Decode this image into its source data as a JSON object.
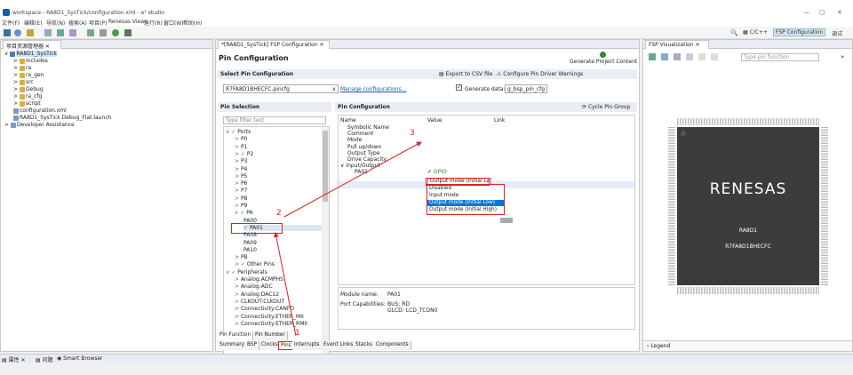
{
  "window": {
    "title": "workspace - RA8D1_SysTick/configuration.xml - e² studio",
    "controls": [
      "—",
      "▢",
      "✕"
    ]
  },
  "menu": [
    "文件(F)",
    "编辑(E)",
    "导航(N)",
    "搜索(A)",
    "项目(P)",
    "Renesas Views",
    "运行(R)",
    "窗口(W)",
    "帮助(H)"
  ],
  "perspective": {
    "c": "C/C++",
    "fsp": "FSP Configuration",
    "debug": "调试"
  },
  "project_explorer": {
    "tab": "项目资源管理器",
    "items": [
      {
        "label": "RA8D1_SysTick",
        "level": 0
      },
      {
        "label": "Includes",
        "level": 1
      },
      {
        "label": "ra",
        "level": 1
      },
      {
        "label": "ra_gen",
        "level": 1
      },
      {
        "label": "src",
        "level": 1
      },
      {
        "label": "Debug",
        "level": 1
      },
      {
        "label": "ra_cfg",
        "level": 1
      },
      {
        "label": "script",
        "level": 1
      },
      {
        "label": "configuration.xml",
        "level": 1
      },
      {
        "label": "RA8D1_SysTick Debug_Flat.launch",
        "level": 1
      },
      {
        "label": "Developer Assistance",
        "level": 0
      }
    ]
  },
  "editor": {
    "tab": "*[RA8D1_SysTick] FSP Configuration",
    "heading": "Pin Configuration",
    "generate": "Generate Project Content",
    "select_pin_cfg": "Select Pin Configuration",
    "export_csv": "Export to CSV file",
    "configure_warnings": "Configure Pin Driver Warnings",
    "pin_cfg_file": "R7FA8D1BHECFC.pincfg",
    "manage": "Manage configurations...",
    "generate_data_label": "Generate data:",
    "generate_data_value": "g_bsp_pin_cfg",
    "pin_selection": "Pin Selection",
    "pin_configuration": "Pin Configuration",
    "cycle": "Cycle Pin Group",
    "filter_placeholder": "Type filter text"
  },
  "pin_tree": [
    {
      "label": "Ports",
      "level": 0,
      "exp": "∨",
      "chk": true
    },
    {
      "label": "P0",
      "level": 1,
      "exp": ">"
    },
    {
      "label": "P1",
      "level": 1,
      "exp": ">"
    },
    {
      "label": "P2",
      "level": 1,
      "exp": ">",
      "chk": true
    },
    {
      "label": "P3",
      "level": 1,
      "exp": ">"
    },
    {
      "label": "P4",
      "level": 1,
      "exp": ">"
    },
    {
      "label": "P5",
      "level": 1,
      "exp": ">"
    },
    {
      "label": "P6",
      "level": 1,
      "exp": ">"
    },
    {
      "label": "P7",
      "level": 1,
      "exp": ">"
    },
    {
      "label": "P8",
      "level": 1,
      "exp": ">"
    },
    {
      "label": "P9",
      "level": 1,
      "exp": ">"
    },
    {
      "label": "PA",
      "level": 1,
      "exp": "∨",
      "chk": true
    },
    {
      "label": "PA00",
      "level": 2
    },
    {
      "label": "PA01",
      "level": 2,
      "chk": true,
      "sel": true
    },
    {
      "label": "PA08",
      "level": 2
    },
    {
      "label": "PA09",
      "level": 2
    },
    {
      "label": "PA10",
      "level": 2
    },
    {
      "label": "PB",
      "level": 1,
      "exp": ">"
    },
    {
      "label": "Other Pins",
      "level": 1,
      "exp": ">",
      "chk": true
    },
    {
      "label": "Peripherals",
      "level": 0,
      "exp": "∨",
      "chk": true
    },
    {
      "label": "Analog:ACMPHS",
      "level": 1,
      "exp": ">"
    },
    {
      "label": "Analog:ADC",
      "level": 1,
      "exp": ">"
    },
    {
      "label": "Analog:DAC12",
      "level": 1,
      "exp": ">"
    },
    {
      "label": "CLKOUT:CLKOUT",
      "level": 1,
      "exp": ">"
    },
    {
      "label": "Connectivity:CANFD",
      "level": 1,
      "exp": ">"
    },
    {
      "label": "Connectivity:ETHER_MII",
      "level": 1,
      "exp": ">"
    },
    {
      "label": "Connectivity:ETHER_RMII",
      "level": 1,
      "exp": ">"
    }
  ],
  "prop_table": {
    "headers": [
      "Name",
      "Value",
      "Link"
    ],
    "rows": [
      {
        "name": "Symbolic Name",
        "value": "",
        "level": 1
      },
      {
        "name": "Comment",
        "value": "",
        "level": 1
      },
      {
        "name": "Mode",
        "value": "Output mode (Initial L",
        "level": 1,
        "sel": true
      },
      {
        "name": "Pull up/down",
        "value": "",
        "level": 1
      },
      {
        "name": "Output Type",
        "value": "",
        "level": 1
      },
      {
        "name": "Drive Capacity",
        "value": "",
        "level": 1
      },
      {
        "name": "Input/Output",
        "value": "",
        "level": 0,
        "exp": "∨"
      },
      {
        "name": "PA01",
        "value": "✔ GPIO",
        "level": 2
      }
    ]
  },
  "mode_options": [
    "Disabled",
    "Input mode",
    "Output mode (Initial Low)",
    "Output mode (Initial High)"
  ],
  "module": {
    "name_label": "Module name:",
    "name": "PA01",
    "cap_label": "Port Capabilities:",
    "cap1": "BUS: RD",
    "cap2": "GLCD: LCD_TCON0"
  },
  "sub_tabs": [
    "Pin Function",
    "Pin Number"
  ],
  "bottom_tabs": [
    "Summary",
    "BSP",
    "Clocks",
    "Pins",
    "Interrupts",
    "Event Links",
    "Stacks",
    "Components"
  ],
  "fsp_vis": {
    "tab": "FSP Visualization",
    "search_placeholder": "Type pin function",
    "brand": "RENESAS",
    "chip": "RA8D1",
    "part": "R7FA8D1BHECFC",
    "legend": "Legend"
  },
  "bottom_views": [
    "属性",
    "问题",
    "Smart Browser"
  ],
  "annotations": [
    "1",
    "2",
    "3"
  ],
  "colors": {
    "red": "#e02020",
    "selection": "#0078d7",
    "chip": "#3c3c3c",
    "accent": "#2a8a2a"
  }
}
